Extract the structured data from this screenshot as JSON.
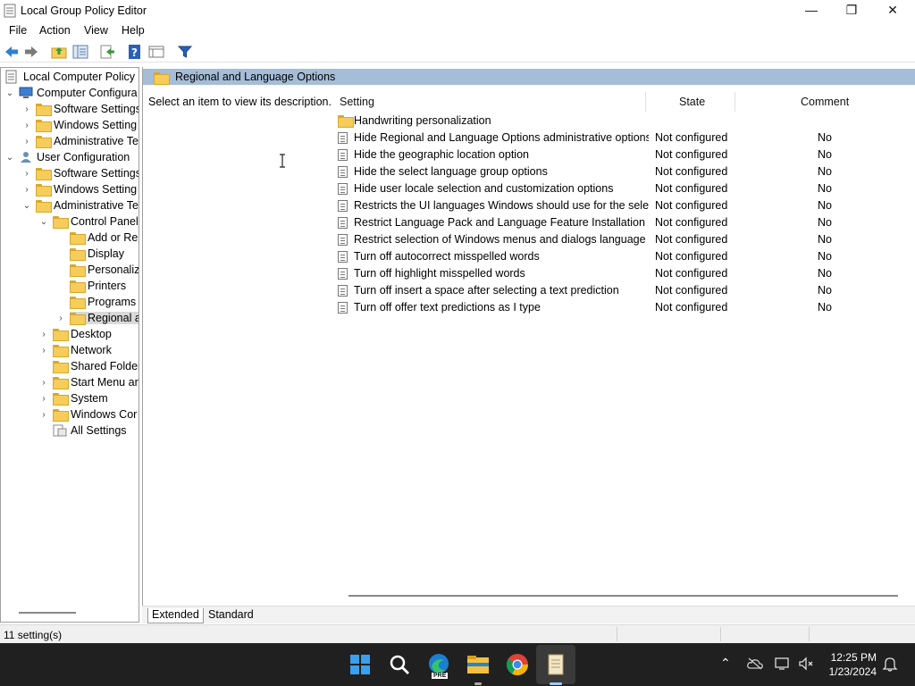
{
  "window": {
    "title": "Local Group Policy Editor",
    "minimize_glyph": "—",
    "maximize_glyph": "❐",
    "close_glyph": "✕"
  },
  "menu": [
    "File",
    "Action",
    "View",
    "Help"
  ],
  "toolbar": {
    "icons": [
      "back-arrow-icon",
      "forward-arrow-icon",
      "up-folder-icon",
      "show-hide-tree-icon",
      "export-list-icon",
      "help-icon",
      "properties-icon",
      "filter-icon"
    ]
  },
  "tree": {
    "root": "Local Computer Policy",
    "items": [
      {
        "label": "Computer Configura",
        "expander": "⌄"
      },
      {
        "label": "Software Settings",
        "expander": "›"
      },
      {
        "label": "Windows Setting",
        "expander": "›"
      },
      {
        "label": "Administrative Te",
        "expander": "›"
      },
      {
        "label": "User Configuration",
        "expander": "⌄"
      },
      {
        "label": "Software Settings",
        "expander": "›"
      },
      {
        "label": "Windows Setting",
        "expander": "›"
      },
      {
        "label": "Administrative Te",
        "expander": "⌄"
      },
      {
        "label": "Control Panel",
        "expander": "⌄"
      },
      {
        "label": "Add or Re",
        "expander": ""
      },
      {
        "label": "Display",
        "expander": ""
      },
      {
        "label": "Personaliz",
        "expander": ""
      },
      {
        "label": "Printers",
        "expander": ""
      },
      {
        "label": "Programs",
        "expander": ""
      },
      {
        "label": "Regional a",
        "expander": "›"
      },
      {
        "label": "Desktop",
        "expander": "›"
      },
      {
        "label": "Network",
        "expander": "›"
      },
      {
        "label": "Shared Folder",
        "expander": ""
      },
      {
        "label": "Start Menu ar",
        "expander": "›"
      },
      {
        "label": "System",
        "expander": "›"
      },
      {
        "label": "Windows Cor",
        "expander": "›"
      },
      {
        "label": "All Settings",
        "expander": ""
      }
    ]
  },
  "details": {
    "header_title": "Regional and Language Options",
    "description": "Select an item to view its description.",
    "columns": {
      "setting": "Setting",
      "state": "State",
      "comment": "Comment"
    },
    "folder_row": "Handwriting personalization",
    "rows": [
      {
        "name": "Hide Regional and Language Options administrative options",
        "state": "Not configured",
        "comment": "No"
      },
      {
        "name": "Hide the geographic location option",
        "state": "Not configured",
        "comment": "No"
      },
      {
        "name": "Hide the select language group options",
        "state": "Not configured",
        "comment": "No"
      },
      {
        "name": "Hide user locale selection and customization options",
        "state": "Not configured",
        "comment": "No"
      },
      {
        "name": "Restricts the UI languages Windows should use for the selec...",
        "state": "Not configured",
        "comment": "No"
      },
      {
        "name": "Restrict Language Pack and Language Feature Installation",
        "state": "Not configured",
        "comment": "No"
      },
      {
        "name": "Restrict selection of Windows menus and dialogs language",
        "state": "Not configured",
        "comment": "No"
      },
      {
        "name": "Turn off autocorrect misspelled words",
        "state": "Not configured",
        "comment": "No"
      },
      {
        "name": "Turn off highlight misspelled words",
        "state": "Not configured",
        "comment": "No"
      },
      {
        "name": "Turn off insert a space after selecting a text prediction",
        "state": "Not configured",
        "comment": "No"
      },
      {
        "name": "Turn off offer text predictions as I type",
        "state": "Not configured",
        "comment": "No"
      }
    ]
  },
  "tabs": {
    "extended": "Extended",
    "standard": "Standard"
  },
  "status": {
    "text": "11 setting(s)"
  },
  "taskbar": {
    "apps": [
      "windows-start-icon",
      "search-icon",
      "edge-pre-icon",
      "file-explorer-icon",
      "chrome-icon",
      "notepad-icon"
    ],
    "edge_badge": "PRE",
    "chevron": "⌃",
    "time": "12:25 PM",
    "date": "1/23/2024"
  },
  "colors": {
    "header_band": "#a5bdd7",
    "folder": "#f6cd5a",
    "taskbar": "#202020",
    "back_arrow": "#2f80d1"
  }
}
